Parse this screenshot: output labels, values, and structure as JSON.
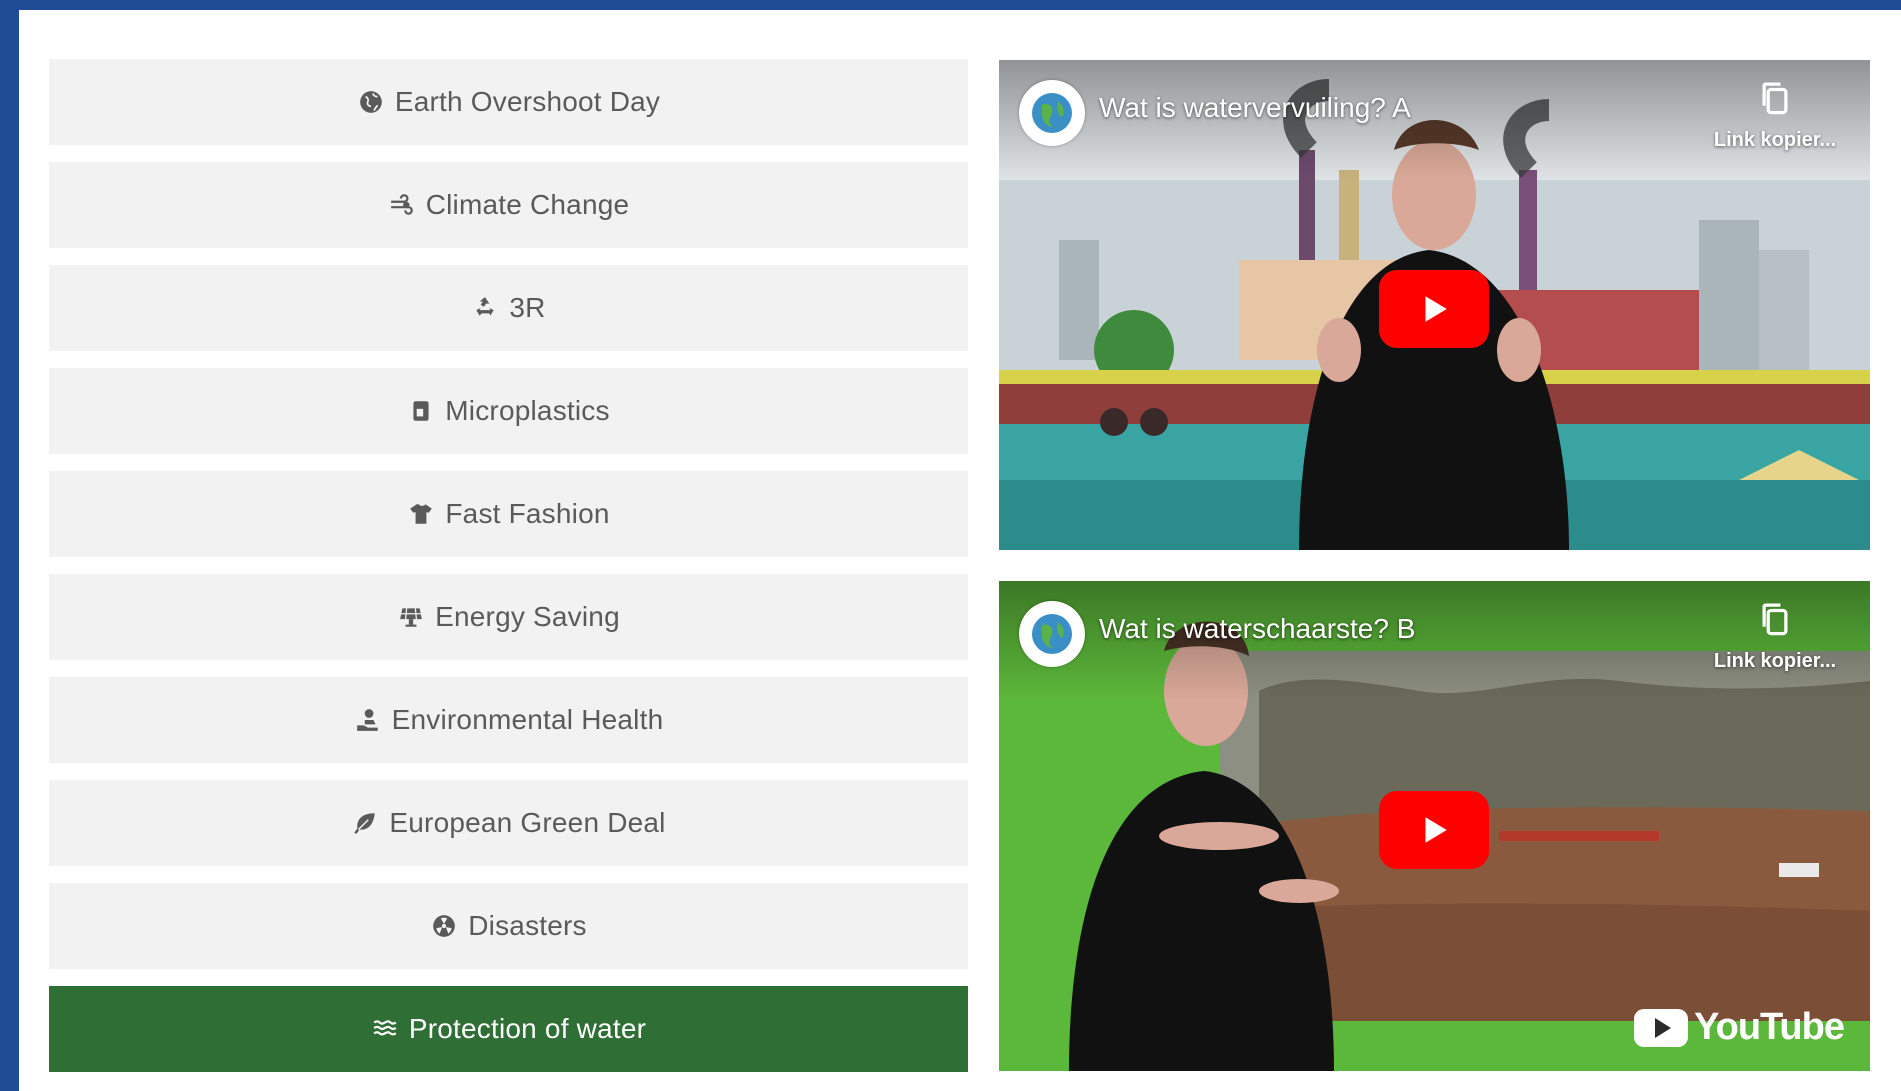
{
  "menu": {
    "items": [
      {
        "label": "Earth Overshoot Day",
        "icon": "globe-icon"
      },
      {
        "label": "Climate Change",
        "icon": "wind-icon"
      },
      {
        "label": "3R",
        "icon": "recycle-icon"
      },
      {
        "label": "Microplastics",
        "icon": "bottle-icon"
      },
      {
        "label": "Fast Fashion",
        "icon": "shirt-icon"
      },
      {
        "label": "Energy Saving",
        "icon": "solar-panel-icon"
      },
      {
        "label": "Environmental Health",
        "icon": "hand-user-icon"
      },
      {
        "label": "European Green Deal",
        "icon": "leaf-icon"
      },
      {
        "label": "Disasters",
        "icon": "radiation-icon"
      },
      {
        "label": "Protection of water",
        "icon": "water-icon"
      }
    ],
    "active_index": 9
  },
  "videos": [
    {
      "title": "Wat is watervervuiling? A",
      "copy_label": "Link kopier..."
    },
    {
      "title": "Wat is waterschaarste? B",
      "copy_label": "Link kopier...",
      "brand": "YouTube"
    }
  ],
  "colors": {
    "frame": "#1f4c94",
    "menu_bg": "#f2f2f2",
    "menu_active": "#2f6e35",
    "play_button": "#ff0000"
  }
}
